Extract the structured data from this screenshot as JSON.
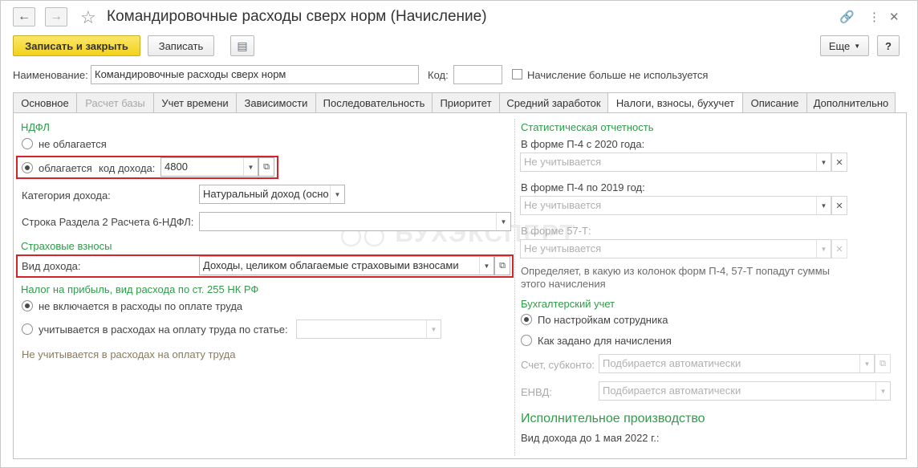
{
  "window": {
    "title": "Командировочные расходы сверх норм (Начисление)"
  },
  "toolbar": {
    "save_close_label": "Записать и закрыть",
    "save_label": "Записать",
    "more_label": "Еще",
    "help_label": "?"
  },
  "header": {
    "name_label": "Наименование:",
    "name_value": "Командировочные расходы сверх норм",
    "code_label": "Код:",
    "code_value": "",
    "not_used_label": "Начисление больше не используется"
  },
  "tabs": [
    {
      "label": "Основное"
    },
    {
      "label": "Расчет базы"
    },
    {
      "label": "Учет времени"
    },
    {
      "label": "Зависимости"
    },
    {
      "label": "Последовательность"
    },
    {
      "label": "Приоритет"
    },
    {
      "label": "Средний заработок"
    },
    {
      "label": "Налоги, взносы, бухучет"
    },
    {
      "label": "Описание"
    },
    {
      "label": "Дополнительно"
    }
  ],
  "ndfl": {
    "title": "НДФЛ",
    "not_taxed": "не облагается",
    "taxed": "облагается",
    "income_code_label": "код дохода:",
    "income_code_value": "4800",
    "category_label": "Категория дохода:",
    "category_value": "Натуральный доход (осно",
    "line_label": "Строка Раздела 2 Расчета 6-НДФЛ:",
    "line_value": ""
  },
  "insurance": {
    "title": "Страховые взносы",
    "income_type_label": "Вид дохода:",
    "income_type_value": "Доходы, целиком облагаемые страховыми взносами"
  },
  "profit_tax": {
    "title": "Налог на прибыль, вид расхода по ст. 255 НК РФ",
    "not_included": "не включается в расходы по оплате труда",
    "included": "учитывается в расходах на оплату труда по статье:",
    "article_value": "",
    "note": "Не учитывается в расходах на оплату труда"
  },
  "stat": {
    "title": "Статистическая отчетность",
    "p4_2020_label": "В форме П-4 с 2020 года:",
    "p4_2020_value": "Не учитывается",
    "p4_2019_label": "В форме П-4 по 2019 год:",
    "p4_2019_value": "Не учитывается",
    "f57t_label": "В форме 57-Т:",
    "f57t_value": "Не учитывается",
    "note_line1": "Определяет, в какую из колонок форм П-4, 57-Т попадут суммы",
    "note_line2": "этого начисления"
  },
  "accounting": {
    "title": "Бухгалтерский учет",
    "by_employee": "По настройкам сотрудника",
    "as_set": "Как задано для начисления",
    "account_label": "Счет, субконто:",
    "account_value": "Подбирается автоматически",
    "envd_label": "ЕНВД:",
    "envd_value": "Подбирается автоматически"
  },
  "enforcement": {
    "title": "Исполнительное производство",
    "income_before_label": "Вид дохода до 1 мая 2022 г.:"
  },
  "watermark": {
    "text": "БУХЭКСПЕРТ"
  },
  "colors": {
    "accent_green": "#2e9c48",
    "primary_button": "#f3d21a",
    "highlight_red": "#d4242b"
  }
}
